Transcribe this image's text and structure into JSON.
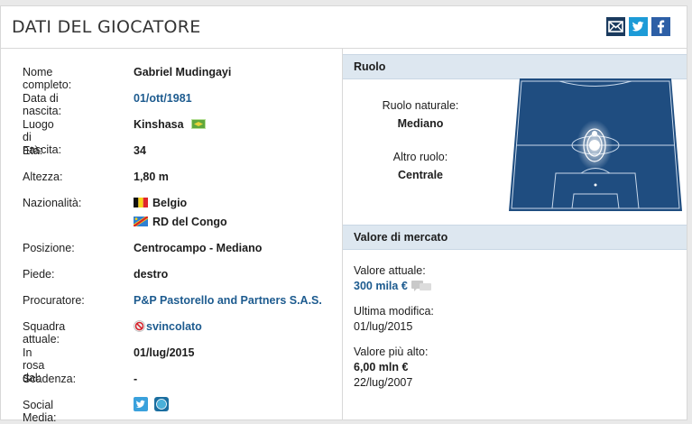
{
  "header": {
    "title": "DATI DEL GIOCATORE"
  },
  "share": {
    "email_icon": "mail-icon",
    "twitter_icon": "twitter-icon",
    "facebook_icon": "facebook-icon"
  },
  "player": {
    "fields": [
      {
        "label": "Nome completo:",
        "value": "Gabriel Mudingayi"
      },
      {
        "label": "Data di nascita:",
        "value": "01/ott/1981"
      },
      {
        "label": "Luogo di nascita:",
        "value": "Kinshasa"
      },
      {
        "label": "Età:",
        "value": "34"
      },
      {
        "label": "Altezza:",
        "value": "1,80 m"
      },
      {
        "label": "Nazionalità:",
        "value": "Belgio",
        "value2": "RD del Congo"
      },
      {
        "label": "Posizione:",
        "value": "Centrocampo - Mediano"
      },
      {
        "label": "Piede:",
        "value": "destro"
      },
      {
        "label": "Procuratore:",
        "value": "P&P Pastorello and Partners S.A.S."
      },
      {
        "label": "Squadra attuale:",
        "value": "svincolato"
      },
      {
        "label": "In rosa dal:",
        "value": "01/lug/2015"
      },
      {
        "label": "Scadenza:",
        "value": "-"
      },
      {
        "label": "Social Media:",
        "value": ""
      }
    ]
  },
  "role": {
    "title": "Ruolo",
    "natural_label": "Ruolo naturale:",
    "natural_value": "Mediano",
    "other_label": "Altro ruolo:",
    "other_value": "Centrale"
  },
  "market": {
    "title": "Valore di mercato",
    "current_label": "Valore attuale:",
    "current_value": "300 mila €",
    "last_change_label": "Ultima modifica:",
    "last_change_value": "01/lug/2015",
    "highest_label": "Valore più alto:",
    "highest_value": "6,00 mln €",
    "highest_date": "22/lug/2007"
  },
  "colors": {
    "accent": "#1d5b8f",
    "pitch": "#1f4d80",
    "section": "#dde7f0"
  }
}
